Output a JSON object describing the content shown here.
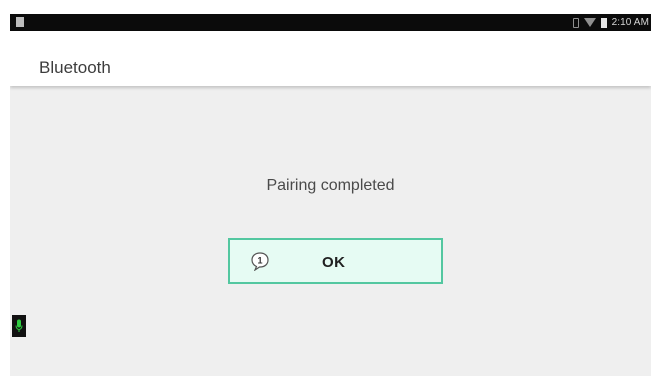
{
  "status_bar": {
    "time": "2:10 AM"
  },
  "app_bar": {
    "title": "Bluetooth"
  },
  "dialog": {
    "message": "Pairing completed",
    "ok_button": {
      "badge": "1",
      "label": "OK"
    }
  },
  "colors": {
    "status_bar": "#0b0b0b",
    "background": "#efefef",
    "accent_border": "#53c7a0",
    "button_fill": "#e6fbf3",
    "mic": "#2ecc40"
  },
  "icons": [
    "notification-icon",
    "bluetooth-icon",
    "wifi-icon",
    "battery-icon",
    "speech-bubble-icon",
    "mic-icon"
  ]
}
